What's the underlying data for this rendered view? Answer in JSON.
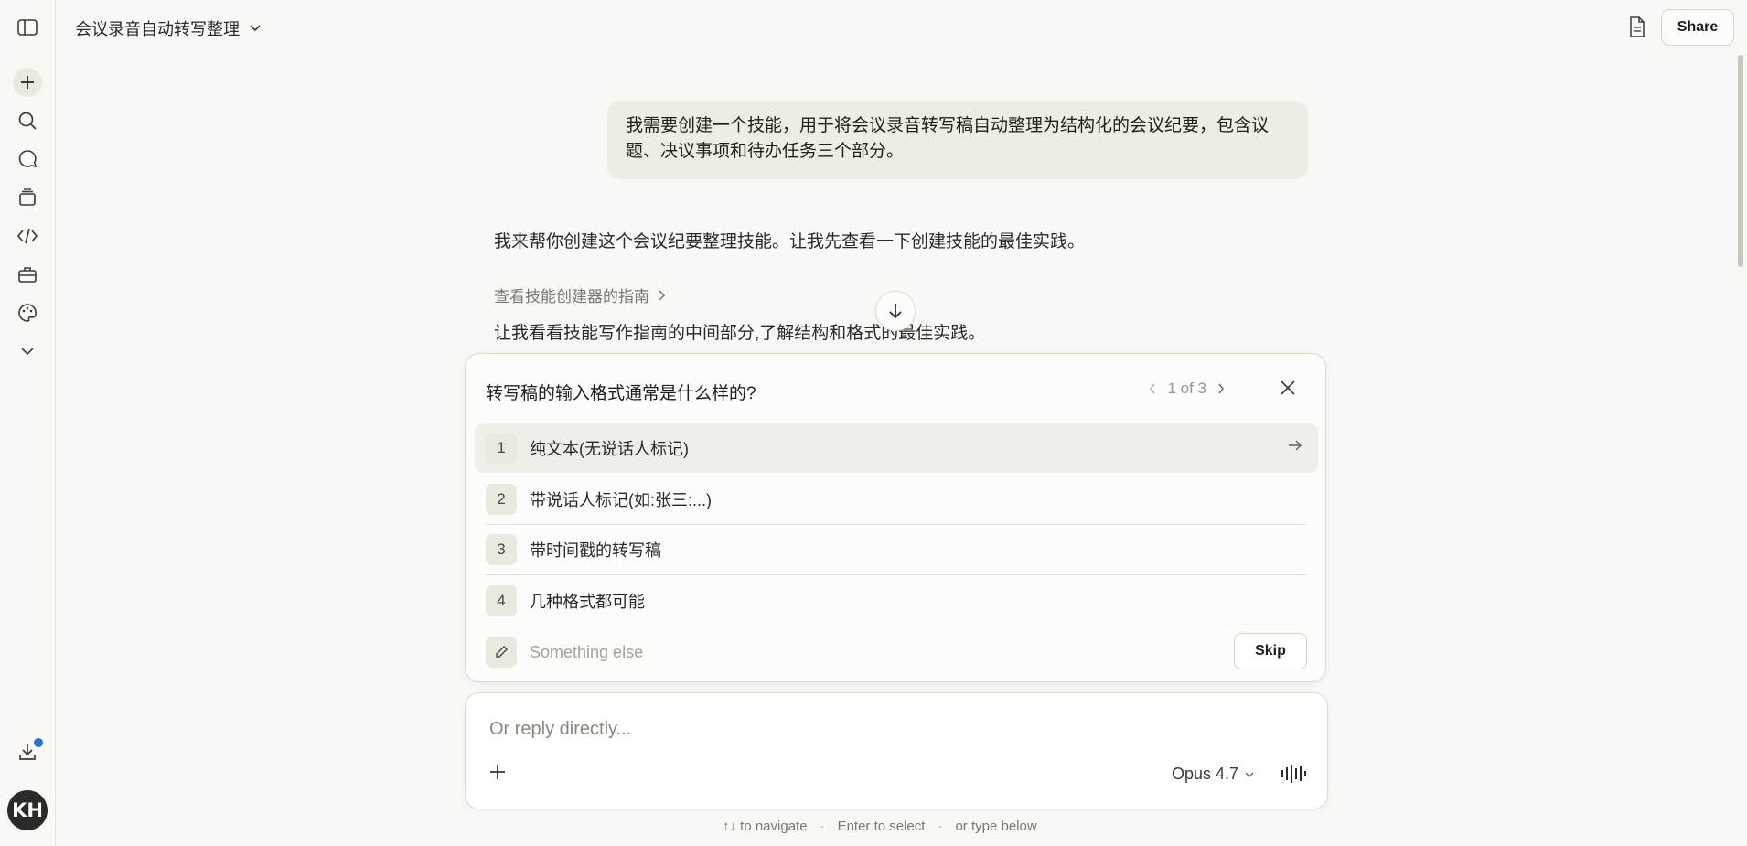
{
  "header": {
    "title": "会议录音自动转写整理",
    "share_label": "Share"
  },
  "sidebar": {
    "icons": [
      "sidebar-toggle-icon",
      "plus-icon",
      "search-icon",
      "chat-icon",
      "projects-icon",
      "code-icon",
      "toolbox-icon",
      "palette-icon",
      "chevron-down-icon",
      "download-icon"
    ],
    "avatar_initials": "KH"
  },
  "conversation": {
    "user_message": "我需要创建一个技能，用于将会议录音转写稿自动整理为结构化的会议纪要，包含议题、决议事项和待办任务三个部分。",
    "assistant_intro": "我来帮你创建这个会议纪要整理技能。让我先查看一下创建技能的最佳实践。",
    "tool_link": "查看技能创建器的指南",
    "assistant_followup": "让我看看技能写作指南的中间部分,了解结构和格式的最佳实践。"
  },
  "question": {
    "title": "转写稿的输入格式通常是什么样的?",
    "pager": "1 of 3",
    "options": [
      {
        "num": "1",
        "label": "纯文本(无说话人标记)"
      },
      {
        "num": "2",
        "label": "带说话人标记(如:张三:...)"
      },
      {
        "num": "3",
        "label": "带时间戳的转写稿"
      },
      {
        "num": "4",
        "label": "几种格式都可能"
      }
    ],
    "other_placeholder": "Something else",
    "skip_label": "Skip"
  },
  "composer": {
    "placeholder": "Or reply directly...",
    "model": "Opus 4.7"
  },
  "hints": {
    "navigate": "↑↓ to navigate",
    "select": "Enter to select",
    "type": "or type below",
    "separator": "·"
  }
}
